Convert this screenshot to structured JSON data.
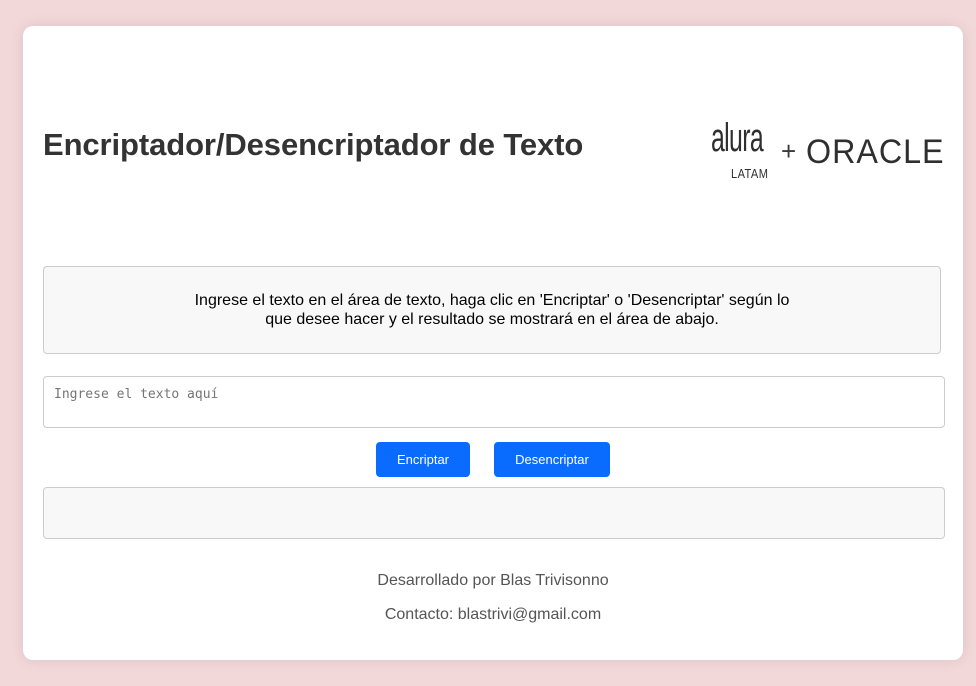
{
  "header": {
    "title": "Encriptador/Desencriptador de Texto",
    "logo": {
      "alura": "alura",
      "latam": "LATAM",
      "plus": "+",
      "oracle": "ORACLE"
    }
  },
  "instructions": {
    "text": "Ingrese el texto en el área de texto, haga clic en 'Encriptar' o 'Desencriptar' según lo que desee hacer y el resultado se mostrará en el área de abajo."
  },
  "input": {
    "placeholder": "Ingrese el texto aquí",
    "value": ""
  },
  "buttons": {
    "encrypt_label": "Encriptar",
    "decrypt_label": "Desencriptar"
  },
  "output": {
    "value": ""
  },
  "footer": {
    "developer": "Desarrollado por Blas Trivisonno",
    "contact": "Contacto: blastrivi@gmail.com"
  },
  "colors": {
    "page_background": "#f3d8da",
    "card_background": "#ffffff",
    "button_primary": "#0a6cff",
    "title_text": "#333333",
    "footer_text": "#555555"
  }
}
